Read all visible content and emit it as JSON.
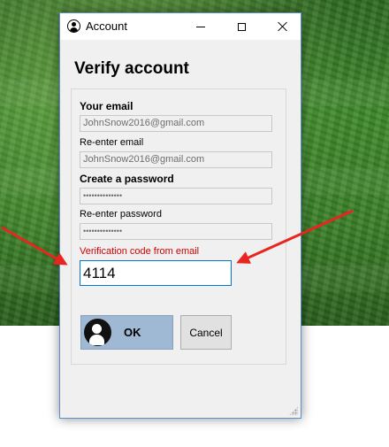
{
  "window": {
    "title": "Account",
    "minimize_glyph": "minimize-icon",
    "maximize_glyph": "maximize-icon",
    "close_glyph": "close-icon"
  },
  "form": {
    "heading": "Verify account",
    "email_label": "Your email",
    "email_value": "JohnSnow2016@gmail.com",
    "reenter_email_label": "Re-enter email",
    "reenter_email_value": "JohnSnow2016@gmail.com",
    "password_label": "Create a password",
    "password_value": "••••••••••••••",
    "reenter_password_label": "Re-enter password",
    "reenter_password_value": "••••••••••••••",
    "code_label": "Verification code from email",
    "code_value": "4114",
    "ok_label": "OK",
    "cancel_label": "Cancel"
  },
  "colors": {
    "code_label": "#d40000",
    "annotation_arrows": "#e8251f",
    "ok_button": "#9fb9d4",
    "window_border": "#5a8fc7"
  }
}
